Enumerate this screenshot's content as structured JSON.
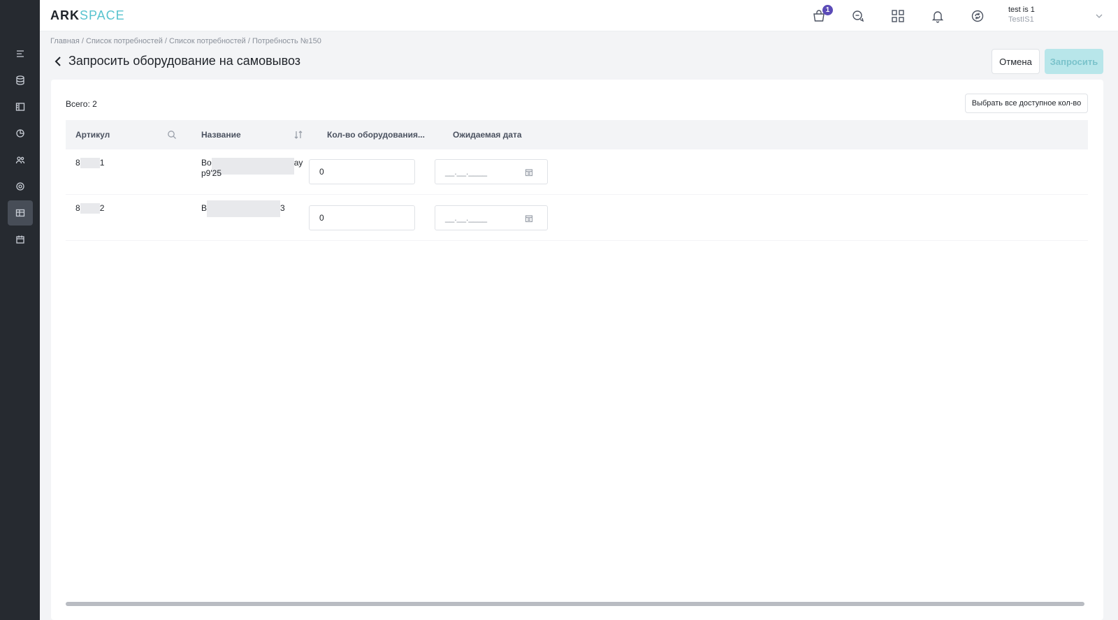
{
  "app": {
    "logo_ark": "ARK",
    "logo_space": "SPACE"
  },
  "header": {
    "cart_badge": "1",
    "user_name": "test is 1",
    "user_company": "TestIS1"
  },
  "breadcrumb": "Главная / Список потребностей / Список потребностей / Потребность №150",
  "page_title": "Запросить оборудование на самовывоз",
  "actions": {
    "cancel_label": "Отмена",
    "request_label": "Запросить"
  },
  "card": {
    "total_label": "Всего: 2",
    "select_all_label": "Выбрать все доступное кол-во",
    "columns": {
      "article": "Артикул",
      "name": "Название",
      "qty": "Кол-во оборудования...",
      "date": "Ожидаемая дата"
    },
    "rows": [
      {
        "article_start": "8",
        "article_end": "1",
        "name_line1_start": "Bo",
        "name_line1_end": "ay",
        "name_line2": "p9'25",
        "qty_value": "0",
        "date_mask": "__.__.____"
      },
      {
        "article_start": "8",
        "article_end": "2",
        "name_line1_start": "B",
        "name_line1_end": "3",
        "name_line2": "",
        "qty_value": "0",
        "date_mask": "__.__.____"
      }
    ]
  },
  "icons": {
    "sidebar": [
      "list-icon",
      "database-icon",
      "panel-icon",
      "chart-icon",
      "users-icon",
      "settings-icon",
      "table-icon",
      "calendar-icon"
    ],
    "header": [
      "cart-icon",
      "chat-icon",
      "grid-icon",
      "bell-icon",
      "sync-icon"
    ]
  },
  "colors": {
    "sidebar_bg": "#262a30",
    "accent": "#58c3cf",
    "badge": "#5b4bb7",
    "request_disabled_bg": "#b8e6ea"
  }
}
